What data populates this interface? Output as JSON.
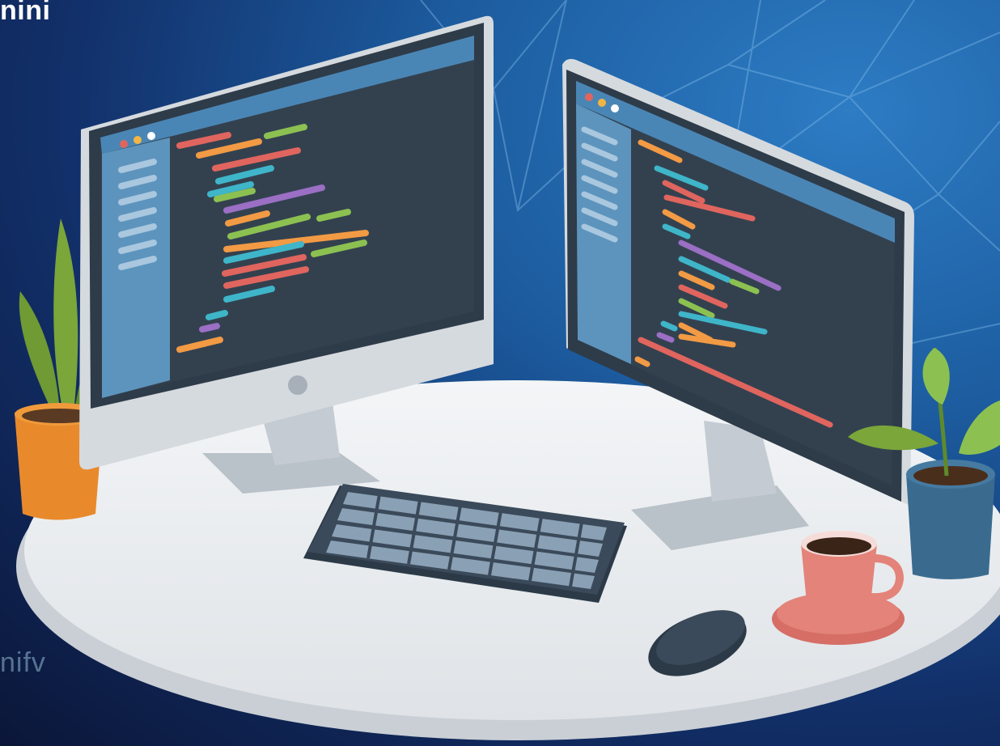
{
  "header": {
    "corner_text": "nini"
  },
  "watermark": {
    "text": "nifv"
  },
  "colors": {
    "background_light": "#2d7cc4",
    "background_dark": "#0b1638",
    "desk": "#e9ecef",
    "monitor_frame": "#2e3b49",
    "screen": "#33414f",
    "sidebar": "#5d94bd",
    "code_orange": "#f29a44",
    "code_red": "#e0655e",
    "code_green": "#8cc152",
    "code_teal": "#3fb5c9",
    "code_purple": "#9a6fc4",
    "plant_green": "#7aa63a",
    "pot_orange": "#e88a2c",
    "pot_blue": "#3a6b8f",
    "cup_pink": "#e38379"
  },
  "objects": {
    "left_monitor_icon": "desktop-monitor-icon",
    "right_monitor_icon": "desktop-monitor-icon",
    "keyboard_icon": "keyboard-icon",
    "mouse_icon": "mouse-icon",
    "cup_icon": "coffee-cup-icon",
    "plant_icon": "potted-plant-icon"
  }
}
